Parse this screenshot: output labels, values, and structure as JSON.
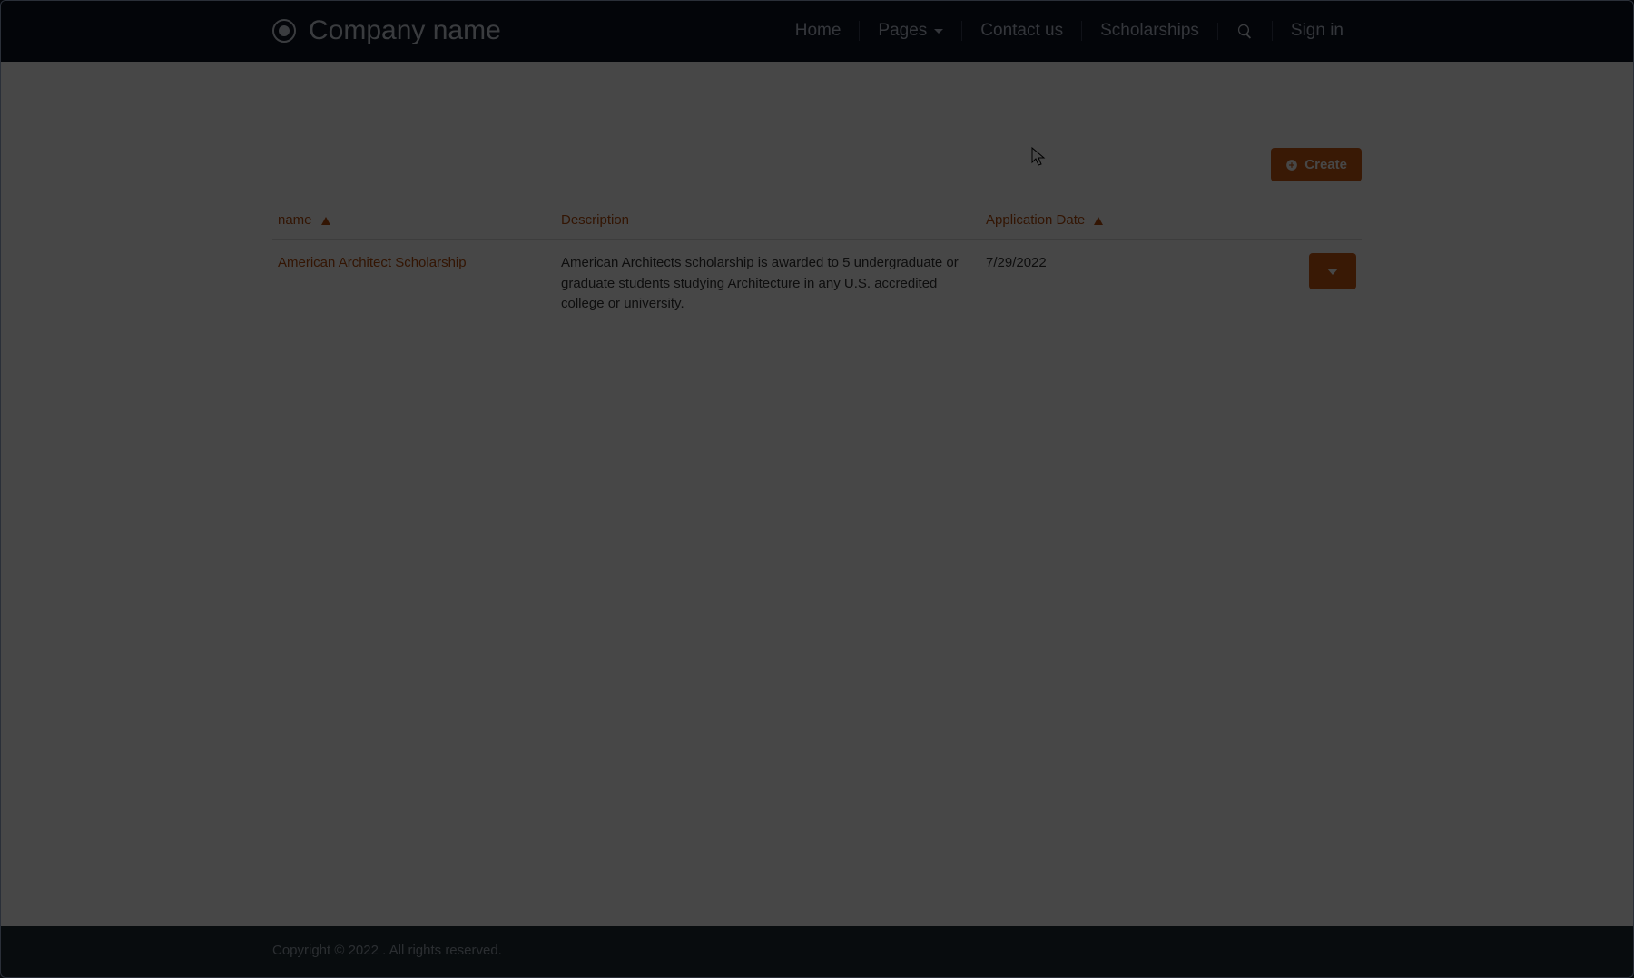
{
  "brand": {
    "name": "Company name"
  },
  "nav": {
    "home": "Home",
    "pages": "Pages",
    "contact": "Contact us",
    "scholarships": "Scholarships",
    "signin": "Sign in"
  },
  "toolbar": {
    "create_label": "Create"
  },
  "table": {
    "headers": {
      "name": "name",
      "description": "Description",
      "application_date": "Application Date"
    },
    "rows": [
      {
        "name": "American Architect Scholarship",
        "description": "American Architects scholarship is awarded to 5 undergraduate or graduate students studying Architecture in any U.S. accredited college or university.",
        "application_date": "7/29/2022"
      }
    ]
  },
  "footer": {
    "text": "Copyright © 2022 . All rights reserved."
  },
  "colors": {
    "accent": "#cc5a12",
    "navbg": "#0d1320"
  }
}
